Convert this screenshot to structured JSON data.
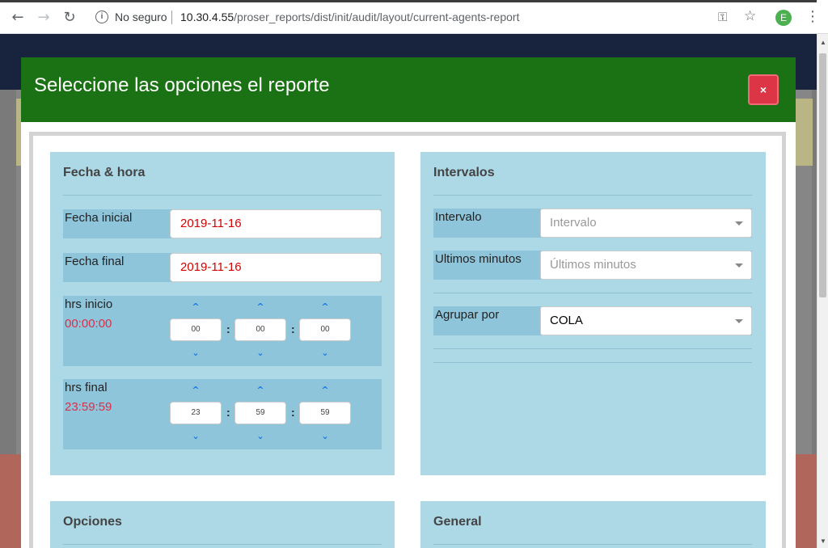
{
  "browser": {
    "not_secure": "No seguro",
    "url_host": "10.30.4.55",
    "url_path": "/proser_reports/dist/init/audit/layout/current-agents-report",
    "profile_initial": "E"
  },
  "modal": {
    "title": "Seleccione las opciones el reporte",
    "close_label": "×"
  },
  "fecha_hora": {
    "title": "Fecha & hora",
    "fecha_inicial_label": "Fecha inicial",
    "fecha_inicial_value": "2019-11-16",
    "fecha_final_label": "Fecha final",
    "fecha_final_value": "2019-11-16",
    "hrs_inicio_label": "hrs inicio",
    "hrs_inicio_value": "00:00:00",
    "hrs_inicio_h": "00",
    "hrs_inicio_m": "00",
    "hrs_inicio_s": "00",
    "hrs_final_label": "hrs final",
    "hrs_final_value": "23:59:59",
    "hrs_final_h": "23",
    "hrs_final_m": "59",
    "hrs_final_s": "59",
    "separator": ":"
  },
  "intervalos": {
    "title": "Intervalos",
    "intervalo_label": "Intervalo",
    "intervalo_placeholder": "Intervalo",
    "ultimos_label": "Ultimos minutos",
    "ultimos_placeholder": "Últimos minutos",
    "agrupar_label": "Agrupar por",
    "agrupar_value": "COLA"
  },
  "opciones": {
    "title": "Opciones"
  },
  "general": {
    "title": "General"
  },
  "colors": {
    "header_green": "#1b7214",
    "card_blue": "#add8e6",
    "row_blue": "#8fc5db",
    "close_red": "#dc3545",
    "date_red": "#d40000"
  }
}
